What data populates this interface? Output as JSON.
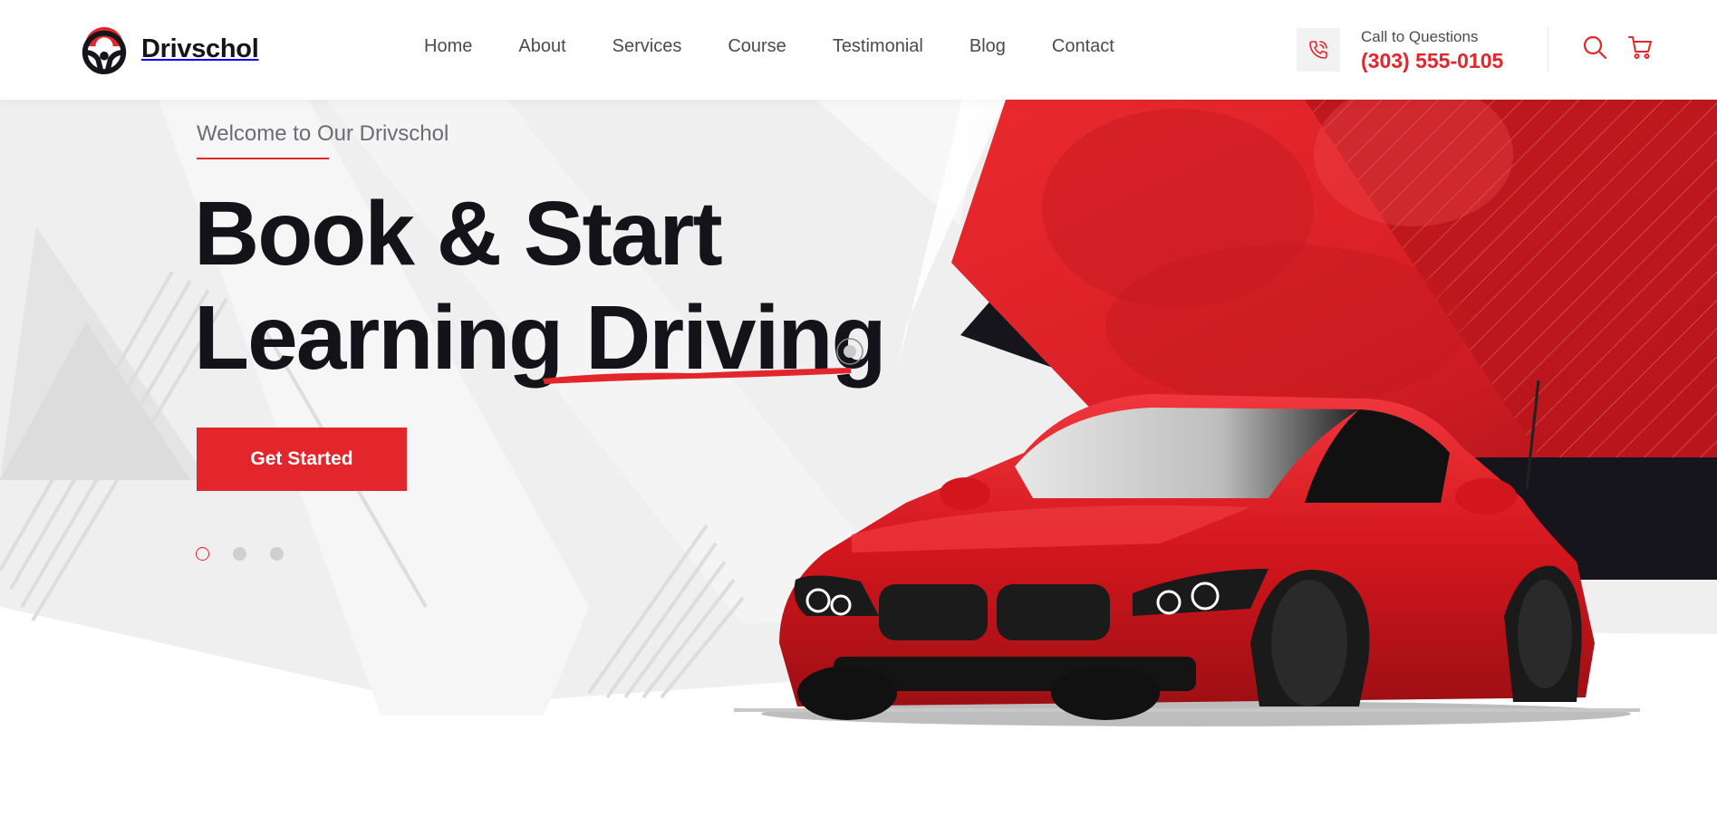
{
  "brand": {
    "name": "Drivschol"
  },
  "nav": {
    "items": [
      {
        "label": "Home"
      },
      {
        "label": "About"
      },
      {
        "label": "Services"
      },
      {
        "label": "Course"
      },
      {
        "label": "Testimonial"
      },
      {
        "label": "Blog"
      },
      {
        "label": "Contact"
      }
    ]
  },
  "contact": {
    "label": "Call to Questions",
    "phone": "(303) 555-0105",
    "icon": "phone-icon"
  },
  "header_icons": [
    "search-icon",
    "cart-icon"
  ],
  "hero": {
    "welcome": "Welcome to Our Drivschol",
    "title_line1": "Book & Start",
    "title_line2_a": "Learning ",
    "title_line2_b": "Driving",
    "cta_label": "Get Started",
    "slides_count": 3,
    "active_slide": 1
  },
  "colors": {
    "accent": "#e3262b",
    "dark": "#14131a",
    "text_muted": "#4a4a52",
    "bg_light": "#efefef"
  }
}
